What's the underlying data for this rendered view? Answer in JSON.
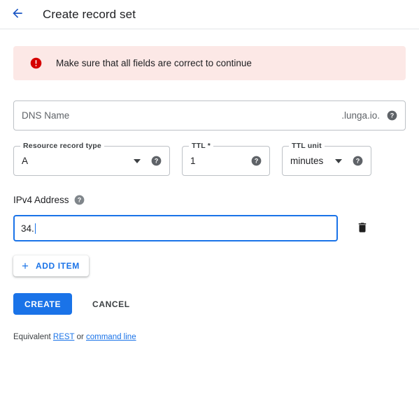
{
  "header": {
    "back_icon": "back-arrow-icon",
    "title": "Create record set"
  },
  "alert": {
    "icon": "error-icon",
    "message": "Make sure that all fields are correct to continue",
    "bg_color": "#fce8e6",
    "icon_color": "#d93025"
  },
  "form": {
    "dns_name": {
      "placeholder": "DNS Name",
      "value": "",
      "suffix": ".lunga.io.",
      "help_icon": "help-icon"
    },
    "resource_record_type": {
      "label": "Resource record type",
      "value": "A",
      "caret_icon": "chevron-down-icon",
      "help_icon": "help-icon"
    },
    "ttl": {
      "label": "TTL *",
      "value": "1",
      "help_icon": "help-icon"
    },
    "ttl_unit": {
      "label": "TTL unit",
      "value": "minutes",
      "caret_icon": "chevron-down-icon",
      "help_icon": "help-icon"
    },
    "ipv4": {
      "label": "IPv4 Address",
      "help_icon": "help-icon",
      "value": "34.",
      "delete_icon": "trash-icon"
    },
    "add_item": {
      "label": "ADD ITEM",
      "icon": "plus-icon"
    }
  },
  "actions": {
    "create_label": "CREATE",
    "cancel_label": "CANCEL",
    "primary_color": "#1a73e8"
  },
  "equivalent": {
    "prefix": "Equivalent ",
    "rest_link": "REST",
    "middle": " or ",
    "cli_link": "command line"
  }
}
